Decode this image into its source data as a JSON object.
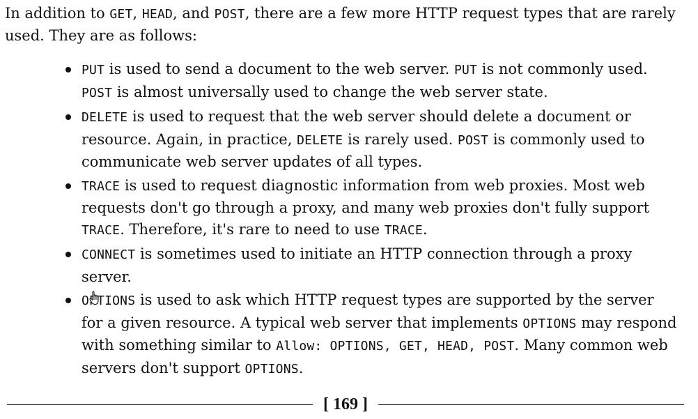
{
  "intro": {
    "t1": "In addition to ",
    "c1": "GET",
    "t2": ", ",
    "c2": "HEAD",
    "t3": ", and ",
    "c3": "POST",
    "t4": ", there are a few more HTTP request types that are rarely used. They are as follows:"
  },
  "items": [
    {
      "c1": "PUT",
      "t1": " is used to send a document to the web server. ",
      "c2": "PUT",
      "t2": " is not commonly used. ",
      "c3": "POST",
      "t3": " is almost universally used to change the web server state."
    },
    {
      "c1": "DELETE",
      "t1": " is used to request that the web server should delete a document or resource. Again, in practice, ",
      "c2": "DELETE",
      "t2": " is rarely used. ",
      "c3": "POST",
      "t3": " is commonly used to communicate web server updates of all types."
    },
    {
      "c1": "TRACE",
      "t1": " is used to request diagnostic information from web proxies. Most web requests don't go through a proxy, and many web proxies don't fully support ",
      "c2": "TRACE",
      "t2": ". Therefore, it's rare to need to use ",
      "c3": "TRACE",
      "t3": "."
    },
    {
      "c1": "CONNECT",
      "t1": " is sometimes used to initiate an HTTP connection through a proxy server."
    },
    {
      "c1": "OPTIONS",
      "t1": " is used to ask which HTTP request types are supported by the server for a given resource. A typical web server that implements ",
      "c2": "OPTIONS",
      "t2": " may respond with something similar to ",
      "c3": "Allow: OPTIONS, GET, HEAD, POST",
      "t3": ". Many common web servers don't support ",
      "c4": "OPTIONS",
      "t4": "."
    }
  ],
  "footer": {
    "page_number": "[ 169 ]"
  },
  "cursor": {
    "icon": "hand-pointer-icon"
  }
}
